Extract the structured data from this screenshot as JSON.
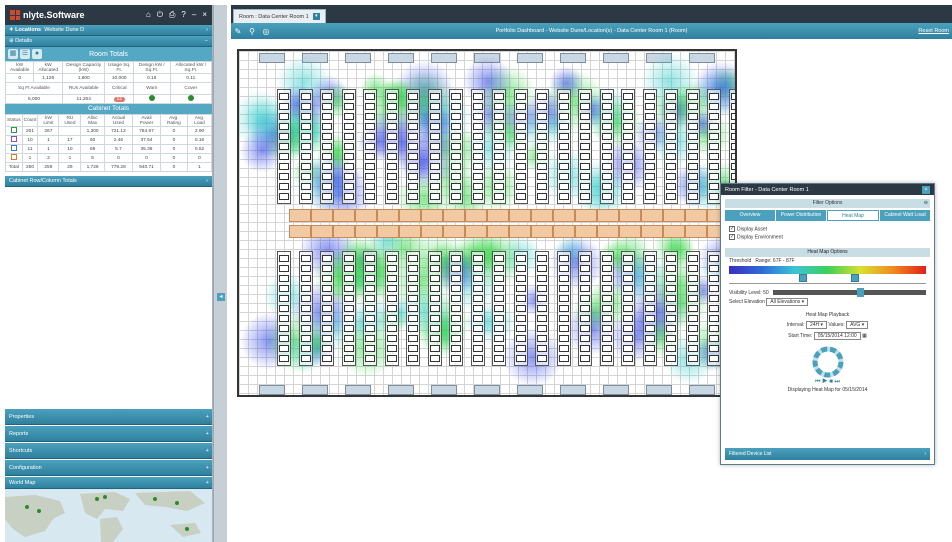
{
  "app": {
    "logo_text": "nlyte.Software",
    "top_icons": [
      "home-icon",
      "power-icon",
      "print-icon",
      "help-icon",
      "minimize-icon",
      "close-icon"
    ]
  },
  "left": {
    "locations": "Locations",
    "locations_value": "Website Dune D",
    "details": "Details",
    "room_totals_title": "Room Totals",
    "room_totals": {
      "headers": [
        "kW Available",
        "kW Allocated",
        "Design Capacity (kW)",
        "Usage Sq. Ft.",
        "Design kW / Sq.Ft.",
        "Allocated kW / Sq.Ft."
      ],
      "values": [
        "0",
        "1,126",
        "1,800",
        "10,000",
        "0.18",
        "0.11"
      ],
      "headers2": [
        "Sq Ft Available",
        "RUs Available",
        "Critical",
        "Warn",
        "Cover"
      ],
      "values2": [
        "5,000",
        "11,264",
        "12",
        "",
        ""
      ]
    },
    "cabinet_totals_title": "Cabinet Totals",
    "cabinet_totals": {
      "headers": [
        "Status",
        "Count",
        "kW Limit",
        "RU Used",
        "Alloc Max",
        "Actual Used",
        "Avail Power",
        "Avg. Rating",
        "Avg. Load"
      ],
      "rows": [
        [
          "",
          "201",
          "267",
          "",
          "1,300",
          "721.12",
          "784.67",
          "0",
          "2.90"
        ],
        [
          "",
          "10",
          "1",
          "17",
          "60",
          "2.46",
          "37.54",
          "0",
          "0.16"
        ],
        [
          "",
          "11",
          "1",
          "10",
          "66",
          "5.7",
          "35.36",
          "0",
          "0.52"
        ],
        [
          "",
          "1",
          "2",
          "1",
          "5",
          "0",
          "0",
          "0",
          "0"
        ],
        [
          "Total",
          "260",
          "259",
          "29",
          "1,726",
          "779.28",
          "940.71",
          "0",
          "1"
        ]
      ],
      "status_colors": [
        "#2a9a3a",
        "#8b4fbf",
        "#3a7ad6",
        "#e07a2a"
      ]
    },
    "cabinet_rows_title": "Cabinet Row/Column Totals",
    "bottom_sections": [
      "Properties",
      "Reports",
      "Shortcuts",
      "Configuration",
      "World Map"
    ]
  },
  "main": {
    "tab_label": "Room : Data Center Room 1",
    "toolbar_title": "Portfolio Dashboard - Website Dune/Location(s) - Data Center Room 1 (Room)",
    "reset_label": "Reset Room"
  },
  "dialog": {
    "title": "Room Filter - Data Center Room 1",
    "filter_options": "Filter Options",
    "tabs": [
      "Overview",
      "Power Distribution",
      "Heat Map",
      "Cabinet Watt Load"
    ],
    "active_tab": "Heat Map",
    "display_asset": "Display Asset",
    "display_environment": "Display Environment",
    "heat_map_options": "Heat Map Options",
    "threshold_label": "Threshold",
    "range_label": "Range: 67F - 87F",
    "visibility_label": "Visibility Level: 50",
    "select_elevation_label": "Select Elevation",
    "select_elevation_value": "All Elevations",
    "playback_title": "Heat Map Playback",
    "interval_label": "Interval:",
    "interval_value": "24H",
    "values_label": "Values:",
    "values_value": "AVG",
    "start_label": "Start Time:",
    "start_value": "05/15/2014 12:00",
    "playback_status": "Displaying Heat Map for 05/15/2014",
    "filtered_device_list": "Filtered Device List"
  }
}
